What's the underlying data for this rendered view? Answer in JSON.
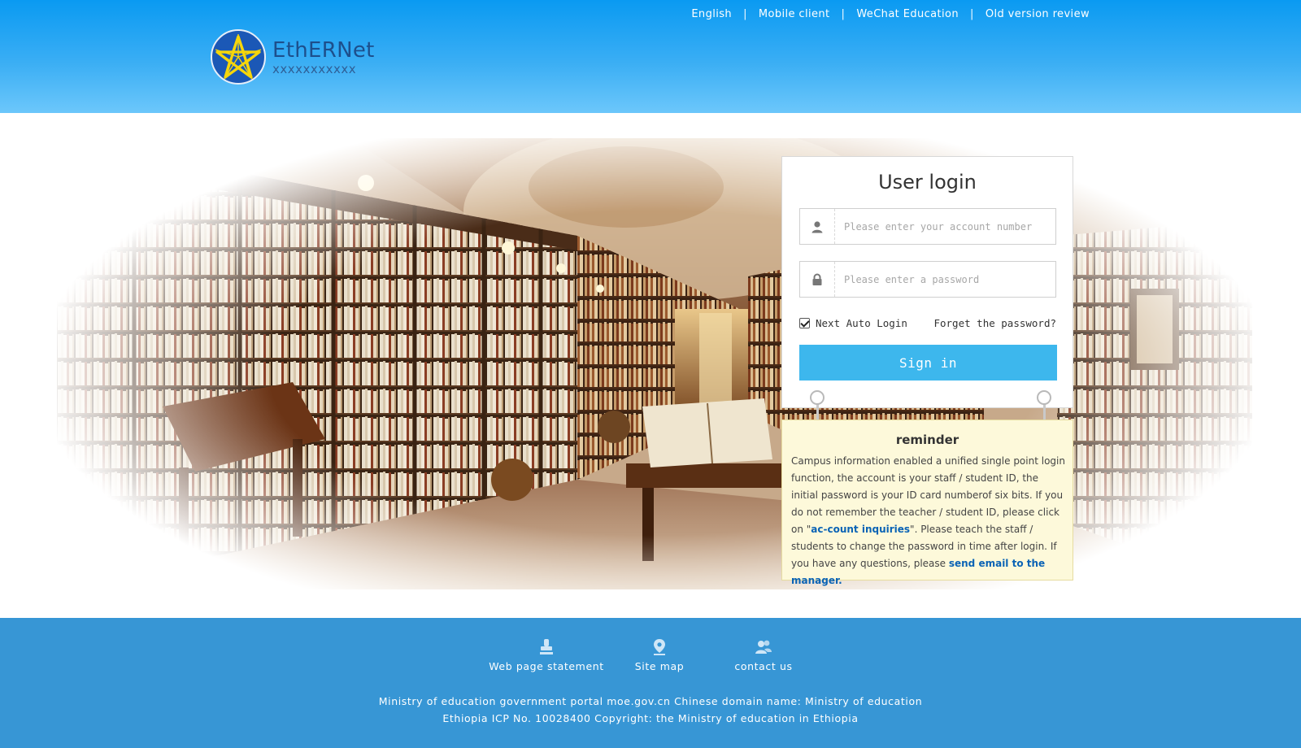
{
  "header": {
    "links": [
      "English",
      "Mobile client",
      "WeChat Education",
      "Old version review"
    ],
    "separator": "|",
    "logo_title": "EthERNet",
    "logo_subtitle": "xxxxxxxxxxx"
  },
  "login": {
    "title": "User login",
    "account_placeholder": "Please enter your account number",
    "password_placeholder": "Please enter a password",
    "auto_login_label": "Next Auto Login",
    "auto_login_checked": true,
    "forget_label": "Forget the password?",
    "signin_label": "Sign in"
  },
  "reminder": {
    "title": "reminder",
    "text_1": "Campus information enabled a unified single point login function, the account is your staff / student ID, the initial password is your ID card numberof six bits. If you do not remember the teacher / student ID, please click on \"",
    "link_1": "ac-count inquiries",
    "text_2": "\". Please teach the staff / students to change the password in time after login. If you have any questions, please ",
    "link_2": "send email to the manager."
  },
  "footer": {
    "links": [
      "Web page statement",
      "Site map",
      "contact us"
    ],
    "copyright_line1": "Ministry of education government portal moe.gov.cn Chinese domain name: Ministry of education",
    "copyright_line2": "Ethiopia ICP No. 10028400 Copyright: the Ministry of education in Ethiopia"
  },
  "colors": {
    "header_blue": "#0a9af2",
    "signin_blue": "#3db7ed",
    "footer_blue": "#3796d5",
    "reminder_bg": "#fdf9da",
    "link_blue": "#0a63b5"
  }
}
